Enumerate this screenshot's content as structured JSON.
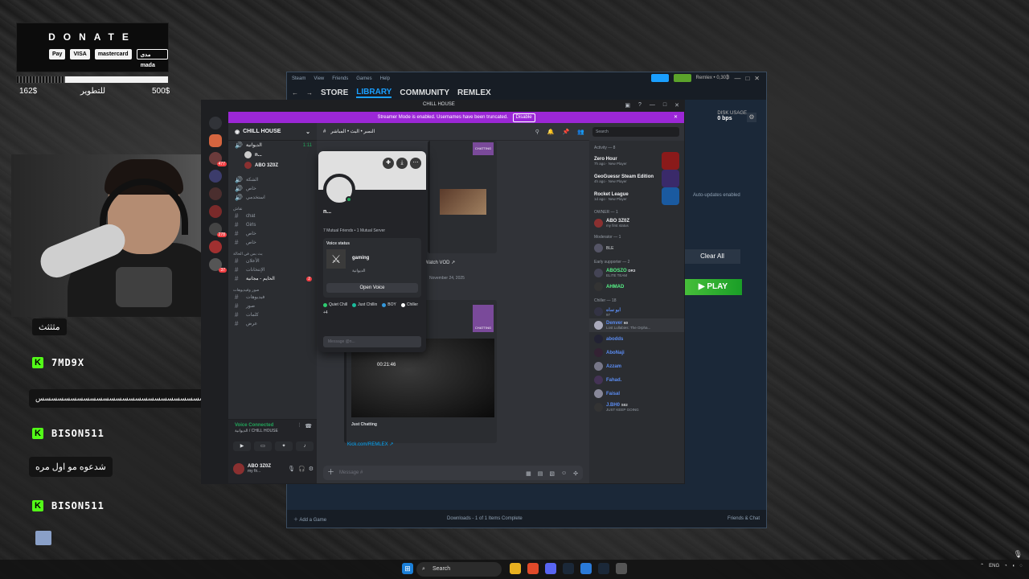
{
  "donate": {
    "title": "DONATE",
    "methods": [
      "Pay",
      "VISA",
      "mastercard",
      "مدى mada"
    ],
    "raised": "162$",
    "goal_label": "للتطوير",
    "goal": "500$",
    "progress": 0.32
  },
  "chat": {
    "msg1": "مثثثث",
    "user1": "7MD9X",
    "msg2": "سسسسسسسسسسسسسسسسسسسسسسسسسسسسسسسسسسسسسسسسس",
    "user2": "BISON511",
    "msg3": "شدعوه مو اول مره",
    "user3": "BISON511",
    "badge": "K"
  },
  "steam": {
    "menu": [
      "Steam",
      "View",
      "Friends",
      "Games",
      "Help"
    ],
    "nav": [
      "STORE",
      "LIBRARY",
      "COMMUNITY",
      "REMLEX"
    ],
    "user": "Remlex • 0,30₿",
    "disk_label": "DISK USAGE",
    "disk_value": "0 bps",
    "auto_updates": "Auto-updates enabled",
    "clear_all": "Clear All",
    "play": "PLAY",
    "add_game": "Add a Game",
    "downloads": "Downloads - 1 of 1 Items Complete",
    "friends_chat": "Friends & Chat"
  },
  "discord": {
    "title": "CHILL HOUSE",
    "banner_text": "Streamer Mode is enabled. Usernames have been truncated.",
    "banner_btn": "Disable",
    "guild": "CHILL HOUSE",
    "voice_channel": "الديوانية",
    "voice_time": "1:11",
    "voice_members": [
      "n...",
      "ABO 3Z0Z"
    ],
    "channels_top": [
      "الشكة",
      "خاص",
      "استخدمي"
    ],
    "category1": "نقاش",
    "channels_mid": [
      "chat",
      "Girls",
      "خاص",
      "خاص"
    ],
    "category2": "بث بس في الحالة",
    "channels_bot": [
      "الأعلان",
      "الإنتخانات",
      "الحايم - مجانية",
      "فيديوهات",
      "صور",
      "كلمات",
      "عرض"
    ],
    "category3": "صور وفيديوهات",
    "live_badge": "2",
    "voice_status": "Voice Connected",
    "voice_sub": "الديوانية / CHILL HOUSE",
    "user_name": "ABO 3Z0Z",
    "user_status": "my fir...",
    "header": "النمبر • البث • المباشر",
    "search": "Search",
    "watch_vod": "Watch VOD",
    "date": "November 24, 2025",
    "stream_time": "00:21:46",
    "just_chatting": "Just Chatting",
    "kick_link": "Kick.com/REMLEX",
    "embed_top_label": "CHATTING",
    "embed_bottom_label": "CHATTING",
    "message_placeholder": "Message #",
    "activity_header": "Activity — 8",
    "activities": [
      {
        "name": "Zero Hour",
        "sub": "7h ago · New Player"
      },
      {
        "name": "GeoGuessr Steam Edition",
        "sub": "4h ago · New Player"
      },
      {
        "name": "Rocket League",
        "sub": "1d ago · New Player"
      }
    ],
    "owner_header": "OWNER — 1",
    "owner": {
      "name": "ABO 3Z0Z",
      "sub": "my first status"
    },
    "mod_header": "Moderator — 1",
    "mod_tag": "BLE",
    "early_header": "Early supporter — 2",
    "early": [
      {
        "name": "ABOSZO",
        "tag": "DR3",
        "sub": "ELITE TEAM"
      },
      {
        "name": "AHMAD",
        "tag": "",
        "sub": ""
      }
    ],
    "chiller_header": "Chiller — 18",
    "chillers": [
      {
        "name": "ابو ساه",
        "sub": "97"
      },
      {
        "name": "Denver",
        "sub": "Lost Lullabies: The Orpha...",
        "tag": "60"
      },
      {
        "name": "abodds",
        "sub": ""
      },
      {
        "name": "AboNaji",
        "sub": ""
      },
      {
        "name": "Azzam",
        "sub": ""
      },
      {
        "name": "Fahad.",
        "sub": ""
      },
      {
        "name": "Faisal",
        "sub": ""
      },
      {
        "name": "J.BH0",
        "sub": "JUST KEEP GOING",
        "tag": "S02"
      }
    ]
  },
  "popout": {
    "name": "n...",
    "mutual": "7 Mutual Friends • 1 Mutual Server",
    "voice_status_label": "Voice status",
    "game": "gaming",
    "voice_channel": "الديوانية",
    "open_voice": "Open Voice",
    "roles": [
      "Quiet Chill",
      "Just Chillin",
      "BOY",
      "Chiller",
      "+4"
    ],
    "message_placeholder": "Message @n..."
  },
  "taskbar": {
    "search": "Search",
    "lang": "ENG"
  },
  "colors": {
    "discord_bg": "#313338",
    "discord_banner": "#9b27d6",
    "steam_bg": "#1b2838",
    "steam_accent": "#1a9fff",
    "play_green": "#47bf3a",
    "kick_green": "#53fc18",
    "voice_green": "#23a55a"
  }
}
